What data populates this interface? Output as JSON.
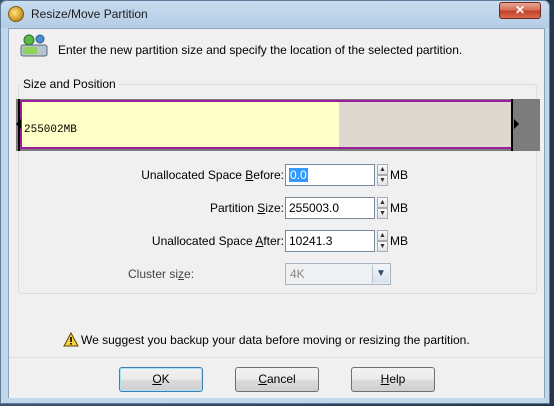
{
  "window": {
    "title": "Resize/Move Partition",
    "close_label": "✕"
  },
  "header": {
    "instruction": "Enter the new partition size and specify the location of the selected partition."
  },
  "group": {
    "legend": "Size and Position"
  },
  "diskmap": {
    "label": "255002MB",
    "used_fraction": 0.65
  },
  "fields": {
    "unallocated_before": {
      "label_pre": "Unallocated Space ",
      "label_key": "B",
      "label_post": "efore:",
      "value": "0.0",
      "unit": "MB"
    },
    "partition_size": {
      "label_pre": "Partition ",
      "label_key": "S",
      "label_post": "ize:",
      "value": "255003.0",
      "unit": "MB"
    },
    "unallocated_after": {
      "label_pre": "Unallocated Space ",
      "label_key": "A",
      "label_post": "fter:",
      "value": "10241.3",
      "unit": "MB"
    },
    "cluster_size": {
      "label_pre": "Cluster si",
      "label_key": "z",
      "label_post": "e:",
      "value": "4K"
    }
  },
  "warning": {
    "text": "We suggest you backup your data before moving or resizing the partition."
  },
  "buttons": {
    "ok": {
      "key": "O",
      "rest": "K"
    },
    "cancel": {
      "key": "C",
      "rest": "ancel"
    },
    "help": {
      "key": "H",
      "rest": "elp"
    }
  }
}
